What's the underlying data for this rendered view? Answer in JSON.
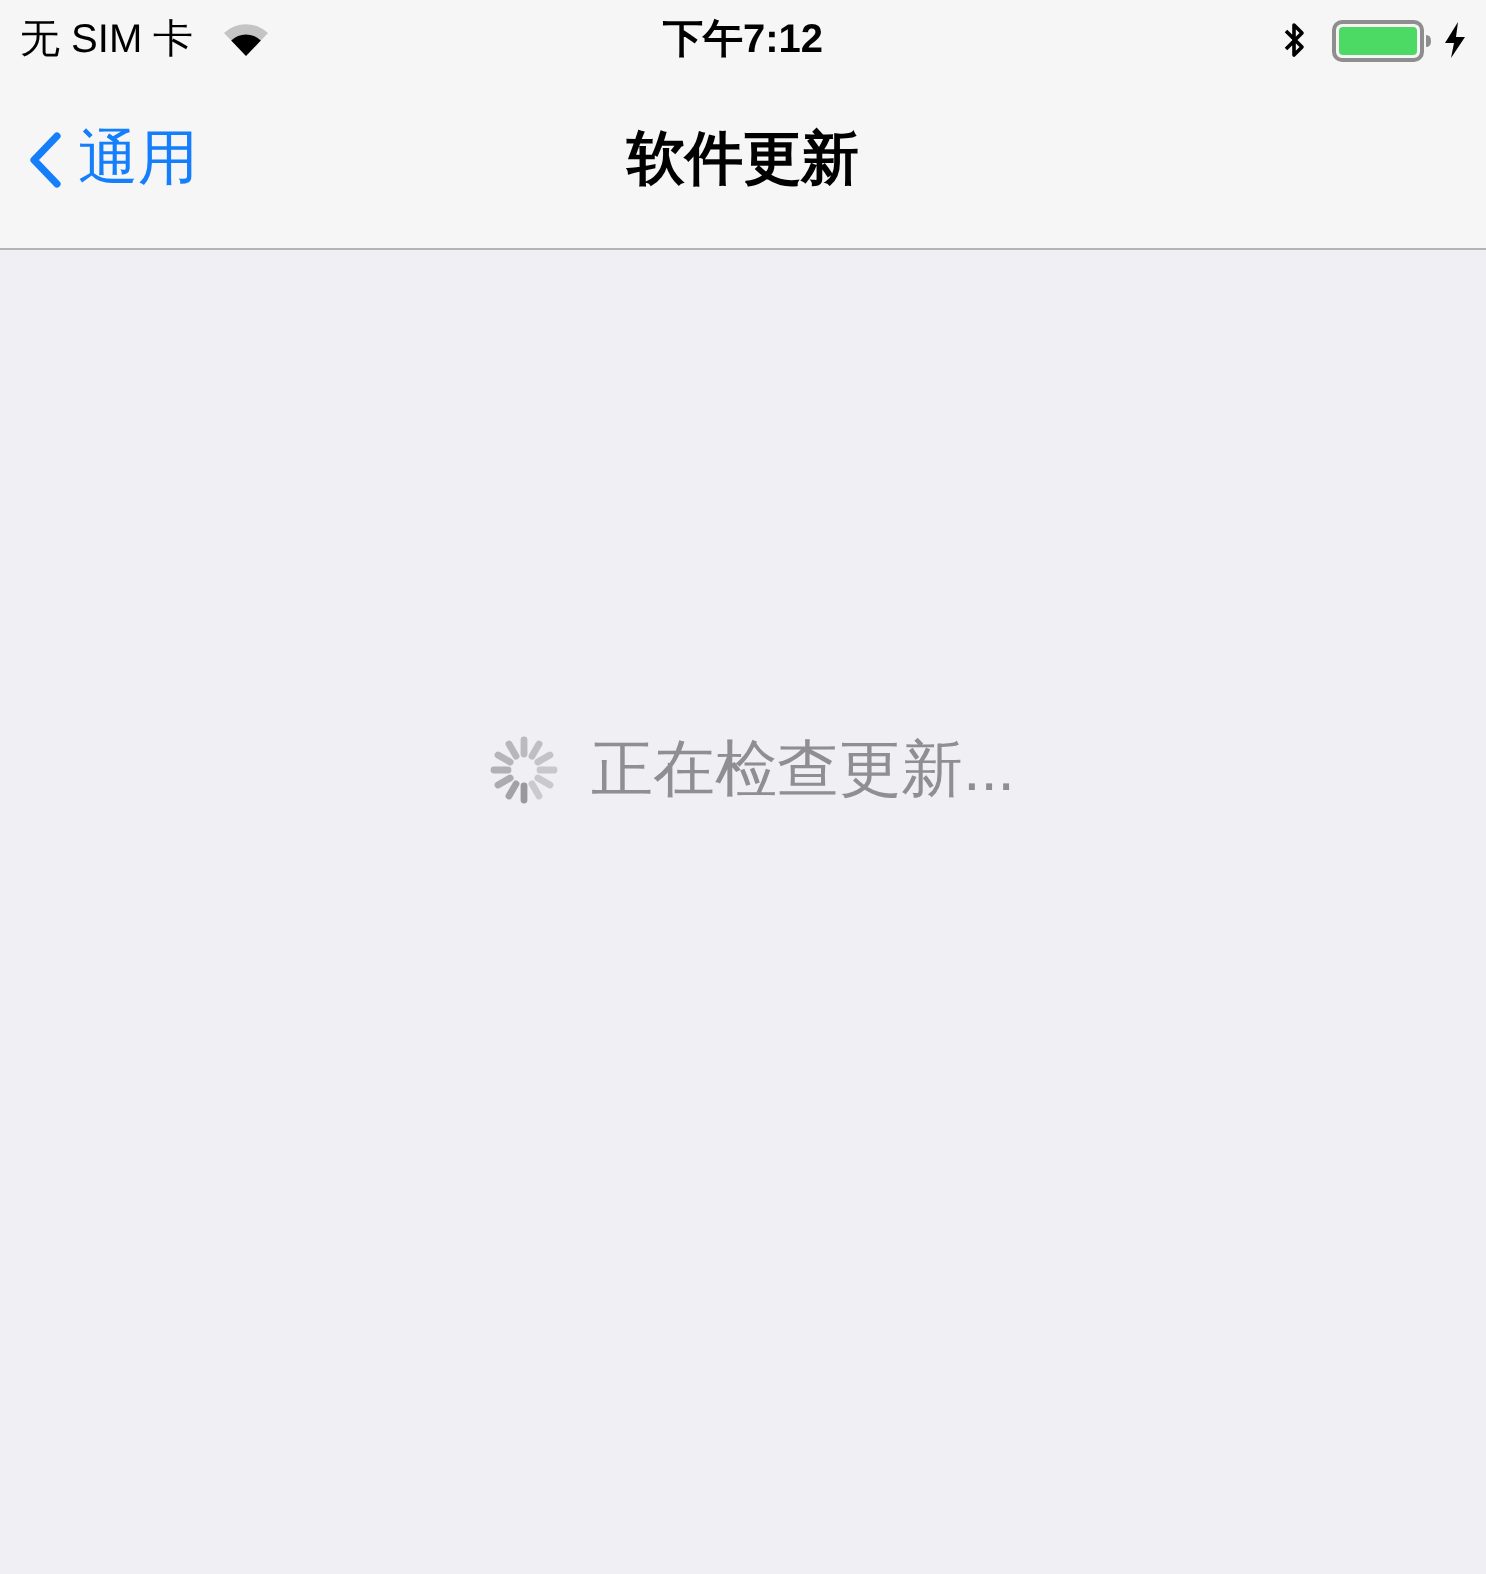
{
  "status_bar": {
    "carrier": "无 SIM 卡",
    "time": "下午7:12"
  },
  "nav_bar": {
    "back_label": "通用",
    "title": "软件更新"
  },
  "content": {
    "message": "正在检查更新..."
  }
}
